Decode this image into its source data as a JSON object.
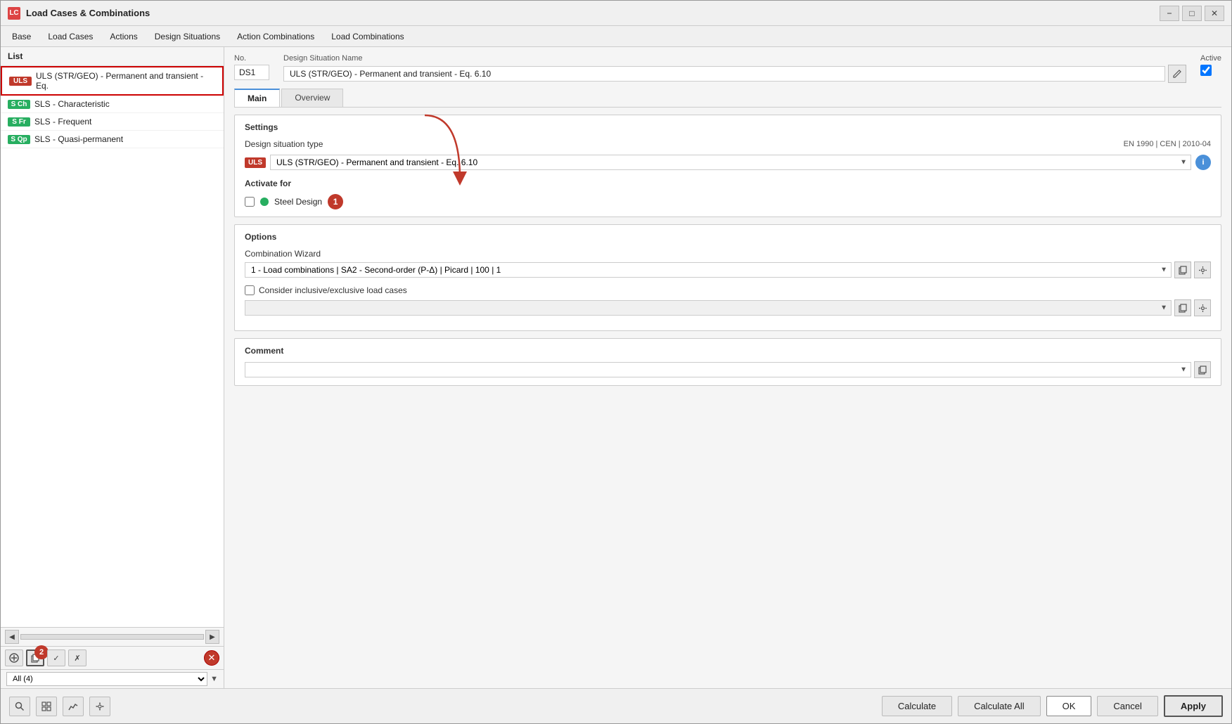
{
  "window": {
    "title": "Load Cases & Combinations",
    "icon": "LC"
  },
  "menu": {
    "items": [
      "Base",
      "Load Cases",
      "Actions",
      "Design Situations",
      "Action Combinations",
      "Load Combinations"
    ]
  },
  "left_panel": {
    "header": "List",
    "items": [
      {
        "badge": "ULS",
        "badge_class": "badge-uls",
        "id": "DS1",
        "text": "ULS (STR/GEO) - Permanent and transient - Eq.",
        "selected": true
      },
      {
        "badge": "S Ch",
        "badge_class": "badge-sch",
        "id": "DS2",
        "text": "SLS - Characteristic",
        "selected": false
      },
      {
        "badge": "S Fr",
        "badge_class": "badge-sfr",
        "id": "DS3",
        "text": "SLS - Frequent",
        "selected": false
      },
      {
        "badge": "S Qp",
        "badge_class": "badge-sqp",
        "id": "DS4",
        "text": "SLS - Quasi-permanent",
        "selected": false
      }
    ],
    "filter_label": "All (4)",
    "step2_label": "2"
  },
  "right_panel": {
    "no_label": "No.",
    "no_value": "DS1",
    "name_label": "Design Situation Name",
    "name_value": "ULS (STR/GEO) - Permanent and transient - Eq. 6.10",
    "active_label": "Active",
    "active_checked": true,
    "tabs": [
      {
        "label": "Main",
        "active": true
      },
      {
        "label": "Overview",
        "active": false
      }
    ],
    "settings": {
      "title": "Settings",
      "type_label": "Design situation type",
      "type_standard": "EN 1990 | CEN | 2010-04",
      "type_badge": "ULS",
      "type_value": "ULS (STR/GEO) - Permanent and transient - Eq. 6.10",
      "activate_label": "Activate for",
      "steel_design_label": "Steel Design",
      "step1_label": "1"
    },
    "options": {
      "title": "Options",
      "wizard_label": "Combination Wizard",
      "wizard_value": "1 - Load combinations | SA2 - Second-order (P-Δ) | Picard | 100 | 1",
      "inclusive_label": "Consider inclusive/exclusive load cases",
      "inclusive_checked": false
    },
    "comment": {
      "title": "Comment",
      "value": ""
    }
  },
  "bottom": {
    "calculate_label": "Calculate",
    "calculate_all_label": "Calculate All",
    "ok_label": "OK",
    "cancel_label": "Cancel",
    "apply_label": "Apply"
  }
}
